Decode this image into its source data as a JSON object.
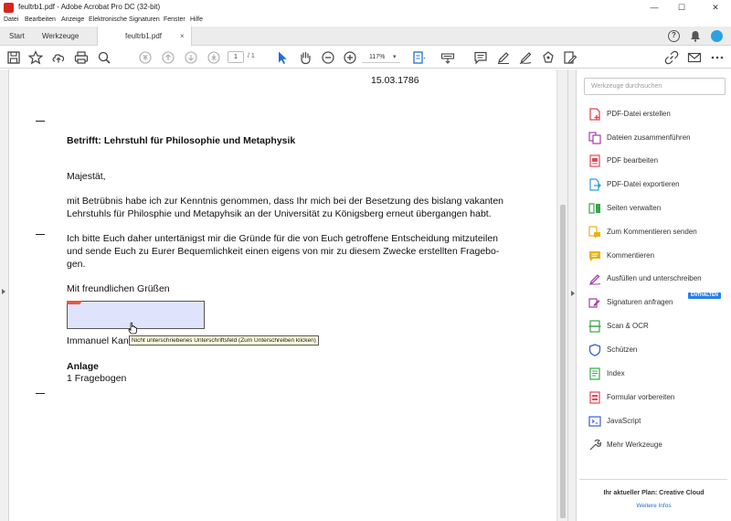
{
  "window": {
    "title": "feultrb1.pdf - Adobe Acrobat Pro DC (32-bit)",
    "minimize": "—",
    "maximize": "☐",
    "close": "✕"
  },
  "menu": [
    "Datei",
    "Bearbeiten",
    "Anzeige",
    "Elektronische Signaturen",
    "Fenster",
    "Hilfe"
  ],
  "tabs": {
    "start": "Start",
    "tools": "Werkzeuge",
    "document": "feultrb1.pdf",
    "close": "×"
  },
  "toolbar": {
    "page_current": "1",
    "page_of": "/  1",
    "zoom": "117%",
    "zoom_caret": "▾"
  },
  "document": {
    "date": "15.03.1786",
    "subject": "Betrifft: Lehrstuhl für Philosophie und Metaphysik",
    "salutation": "Majestät,",
    "para1_line1": "mit Betrübnis habe ich zur Kenntnis genommen, dass Ihr mich bei der Besetzung des bislang vakanten",
    "para1_line2": "Lehrstuhls für Philosphie und Metapyhsik an der Universität zu Königsberg erneut übergangen habt.",
    "para2_line1": "Ich bitte Euch daher untertänigst mir die Gründe für die von Euch getroffene Entscheidung mitzuteilen",
    "para2_line2": "und sende Euch zu Eurer Bequemlichkeit einen eigens von mir zu diesem Zwecke erstellten Frage­bo-",
    "para2_line3": "gen.",
    "closing": "Mit freundlichen Grüßen",
    "signer": "Immanuel Kant",
    "enclosure_heading": "Anlage",
    "enclosure_item": "1 Fragebogen",
    "tooltip": "Nicht unterschriebenes Unterschriftsfeld (Zum Unterschreiben klicken)"
  },
  "tools_pane": {
    "search_placeholder": "Werkzeuge durchsuchen",
    "items": [
      {
        "label": "PDF-Datei erstellen",
        "icon": "create-pdf-icon",
        "color": "#e34850"
      },
      {
        "label": "Dateien zusammenführen",
        "icon": "combine-files-icon",
        "color": "#a43fa5"
      },
      {
        "label": "PDF bearbeiten",
        "icon": "edit-pdf-icon",
        "color": "#e34850"
      },
      {
        "label": "PDF-Datei exportieren",
        "icon": "export-pdf-icon",
        "color": "#2f9fd8"
      },
      {
        "label": "Seiten verwalten",
        "icon": "organize-pages-icon",
        "color": "#3aa54b"
      },
      {
        "label": "Zum Kommentieren senden",
        "icon": "send-for-comments-icon",
        "color": "#e8b312"
      },
      {
        "label": "Kommentieren",
        "icon": "comment-icon",
        "color": "#e8b312"
      },
      {
        "label": "Ausfüllen und unterschreiben",
        "icon": "fill-sign-icon",
        "color": "#a43fa5"
      },
      {
        "label": "Signaturen anfragen",
        "icon": "request-signatures-icon",
        "color": "#a43fa5"
      },
      {
        "label": "Scan & OCR",
        "icon": "scan-ocr-icon",
        "color": "#3aa54b"
      },
      {
        "label": "Schützen",
        "icon": "protect-icon",
        "color": "#3a5fcd"
      },
      {
        "label": "Index",
        "icon": "index-icon",
        "color": "#3aa54b"
      },
      {
        "label": "Formular vorbereiten",
        "icon": "prepare-form-icon",
        "color": "#e34850"
      },
      {
        "label": "JavaScript",
        "icon": "javascript-icon",
        "color": "#3a5fcd"
      },
      {
        "label": "Mehr Werkzeuge",
        "icon": "more-tools-icon",
        "color": "#555555"
      }
    ],
    "new_badge": "ENTHALTEN",
    "plan_text": "Ihr aktueller Plan: Creative Cloud",
    "plan_link": "Weitere Infos"
  },
  "colors": {
    "accent": "#2680eb",
    "signature_field": "#dfe3fb",
    "tooltip_bg": "#ffffe1",
    "acrobat_red": "#d9261c"
  }
}
